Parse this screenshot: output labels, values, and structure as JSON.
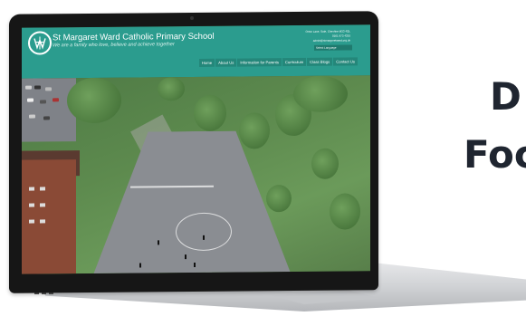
{
  "side_heading": {
    "line1": "D",
    "line2": "Foc"
  },
  "site": {
    "title": "St Margaret Ward Catholic Primary School",
    "tagline": "We are a family who love, believe and achieve together",
    "contact": [
      "Orme Lane, Sale, Cheshire M33 4QL",
      "0161 973 4255",
      "admin@stmargaretward.org.uk"
    ],
    "translate": "Select Language",
    "nav": [
      "Home",
      "About Us",
      "Information for Parents",
      "Curriculum",
      "Class Blogs",
      "Contact Us"
    ]
  },
  "colors": {
    "header": "#2b9c8e",
    "nav_bg": "#24877a"
  }
}
